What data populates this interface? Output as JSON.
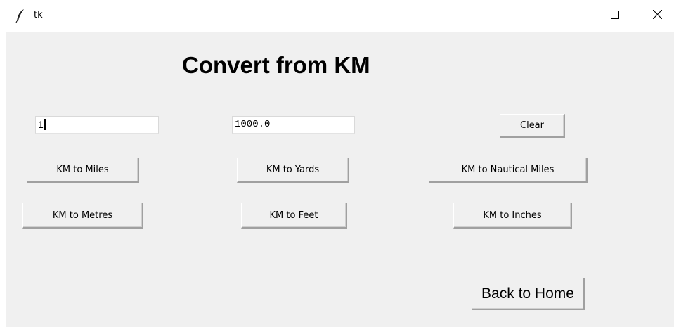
{
  "window": {
    "title": "tk",
    "controls": {
      "minimize_icon": "minimize-icon",
      "maximize_icon": "maximize-icon",
      "close_icon": "close-icon"
    }
  },
  "main": {
    "heading": "Convert from KM",
    "input_value": "1",
    "output_value": "1000.0"
  },
  "buttons": {
    "clear": "Clear",
    "km_to_miles": "KM to Miles",
    "km_to_yards": "KM to Yards",
    "km_to_nautical_miles": "KM to Nautical Miles",
    "km_to_metres": "KM to Metres",
    "km_to_feet": "KM to Feet",
    "km_to_inches": "KM to Inches",
    "back_to_home": "Back to Home"
  }
}
